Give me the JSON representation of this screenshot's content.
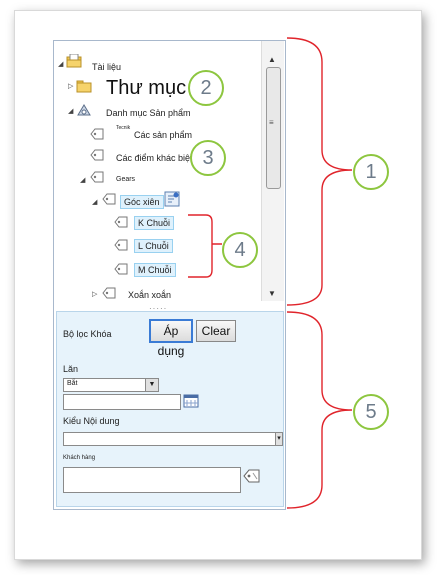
{
  "tree": {
    "root_label": "Tài liệu",
    "folder2_label": "Thư mục 2",
    "catalog_label": "Danh mục Sản phẩm",
    "products_prefix": "Tecnik",
    "products_label": "Các sản phẩm",
    "differences_label": "Các điểm khác biệt",
    "gears_label": "Gears",
    "angle_label": "Góc xiên",
    "k_prefix": "K",
    "k_label": "Chuỗi",
    "l_prefix": "L",
    "l_label": "Chuỗi",
    "m_prefix": "M",
    "m_label": "Chuỗi",
    "spiral_label": "Xoắn xoắn"
  },
  "filter": {
    "title": "Bộ lọc Khóa",
    "apply_label": "Áp dụng",
    "clear_label": "Clear",
    "lan_label": "Lăn",
    "lan_value": "Bắt",
    "content_type_label": "Kiểu Nội dung",
    "customer_label": "Khách hàng"
  },
  "callouts": [
    "1",
    "2",
    "3",
    "4",
    "5"
  ],
  "colors": {
    "callout_border": "#8dc63f",
    "bracket": "#e0242b",
    "filter_bg": "#e7f3fb",
    "highlight": "#dff1fc"
  }
}
